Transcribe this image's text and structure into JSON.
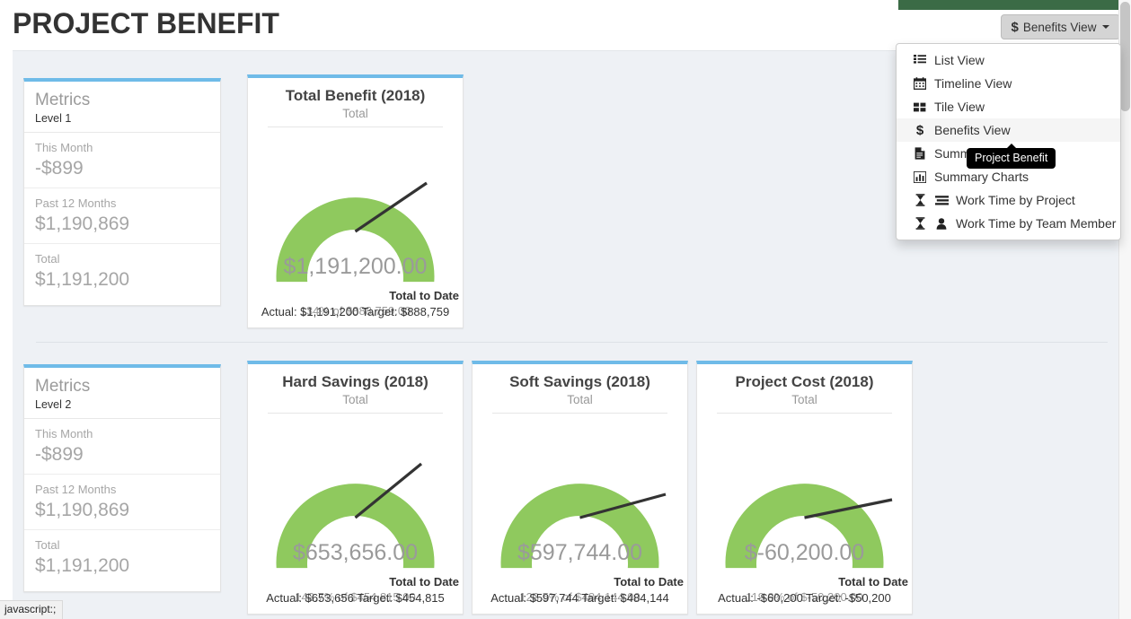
{
  "page": {
    "title": "PROJECT BENEFIT",
    "status_bar_text": "javascript:;",
    "accent_green": "#3b6b46",
    "card_accent": "#6fbbe8",
    "gauge_green": "#8fc95e",
    "background": "#eef1f5"
  },
  "toolbar": {
    "view_button_label": "Benefits View",
    "view_button_icon": "dollar-icon",
    "caret_icon": "caret-down-icon"
  },
  "dropdown": {
    "items": [
      {
        "label": "List View",
        "icon": "list-icon",
        "active": false
      },
      {
        "label": "Timeline View",
        "icon": "calendar-icon",
        "active": false
      },
      {
        "label": "Tile View",
        "icon": "tile-grid-icon",
        "active": false
      },
      {
        "label": "Benefits View",
        "icon": "dollar-icon",
        "active": true
      },
      {
        "label": "Summary Table",
        "icon": "file-text-icon",
        "active": false
      },
      {
        "label": "Summary Charts",
        "icon": "bar-chart-icon",
        "active": false
      },
      {
        "label": "Work Time by Project",
        "icon": "hourglass-list-icon",
        "active": false
      },
      {
        "label": "Work Time by Team Member",
        "icon": "hourglass-user-icon",
        "active": false
      }
    ]
  },
  "tooltip": {
    "text": "Project Benefit"
  },
  "metrics_cards": [
    {
      "title": "Metrics",
      "level": "Level 1",
      "rows": [
        {
          "label": "This Month",
          "value": "-$899"
        },
        {
          "label": "Past 12 Months",
          "value": "$1,190,869"
        },
        {
          "label": "Total",
          "value": "$1,191,200"
        }
      ]
    },
    {
      "title": "Metrics",
      "level": "Level 2",
      "rows": [
        {
          "label": "This Month",
          "value": "-$899"
        },
        {
          "label": "Past 12 Months",
          "value": "$1,190,869"
        },
        {
          "label": "Total",
          "value": "$1,191,200"
        }
      ]
    }
  ],
  "chart_data": [
    {
      "type": "gauge",
      "title": "Total Benefit (2018)",
      "subtitle": "Total",
      "value": 1191200,
      "value_label": "$1,191,200.00",
      "target": 888759,
      "percent": 134,
      "percent_label": "134% of $888,759.00",
      "needle_angle_deg": 56,
      "arc_color": "#8fc95e",
      "footer_title": "Total to Date",
      "footer_detail": "Actual: $1,191,200 Target: $888,759"
    },
    {
      "type": "gauge",
      "title": "Hard Savings (2018)",
      "subtitle": "Total",
      "value": 653656,
      "value_label": "$653,656.00",
      "target": 454815,
      "percent": 143.7,
      "percent_label": "143.7% of $454,815.00",
      "needle_angle_deg": 50,
      "arc_color": "#8fc95e",
      "footer_title": "Total to Date",
      "footer_detail": "Actual: $653,656 Target: $454,815"
    },
    {
      "type": "gauge",
      "title": "Soft Savings (2018)",
      "subtitle": "Total",
      "value": 597744,
      "value_label": "$597,744.00",
      "target": 484144,
      "percent": 123.5,
      "percent_label": "123.5% of $484,144.00",
      "needle_angle_deg": 74,
      "arc_color": "#8fc95e",
      "footer_title": "Total to Date",
      "footer_detail": "Actual: $597,744 Target: $484,144"
    },
    {
      "type": "gauge",
      "title": "Project Cost (2018)",
      "subtitle": "Total",
      "value": -60200,
      "value_label": "$-60,200.00",
      "target": -50200,
      "percent": 119.9,
      "percent_label": "119.9% of $-50,200.00",
      "needle_angle_deg": 78,
      "arc_color": "#8fc95e",
      "footer_title": "Total to Date",
      "footer_detail": "Actual: -$60,200 Target: -$50,200"
    }
  ]
}
